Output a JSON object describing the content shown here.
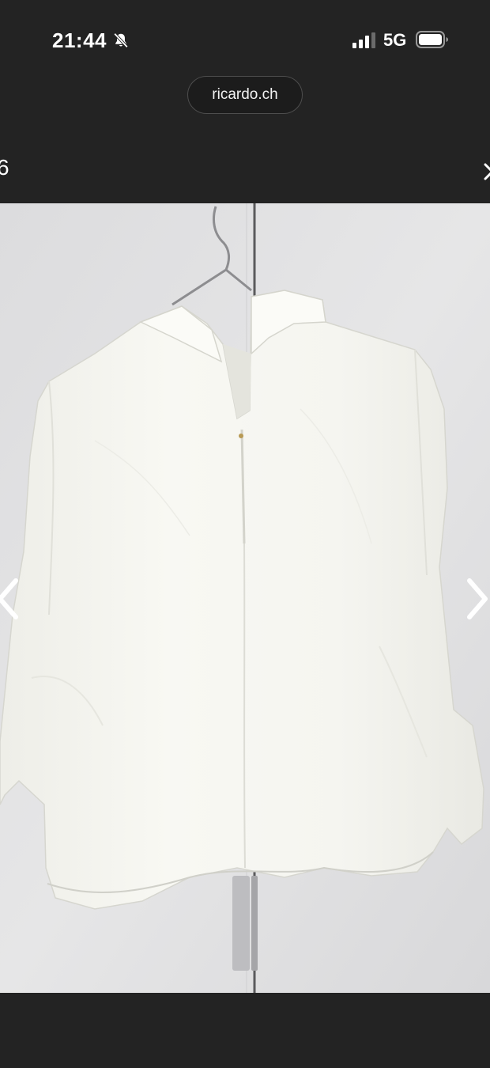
{
  "status_bar": {
    "time": "21:44",
    "network": "5G",
    "icons": [
      "bell-off-icon",
      "signal-icon",
      "battery-icon"
    ]
  },
  "browser": {
    "url": "ricardo.ch"
  },
  "gallery": {
    "counter": "6",
    "close_icon": "close-icon",
    "prev_icon": "chevron-left-icon",
    "next_icon": "chevron-right-icon",
    "photo_subject": "white blouse on hanger"
  },
  "colors": {
    "chrome_background": "#232323",
    "photo_wall": "#e3e3e4",
    "shirt": "#f6f6f1"
  }
}
